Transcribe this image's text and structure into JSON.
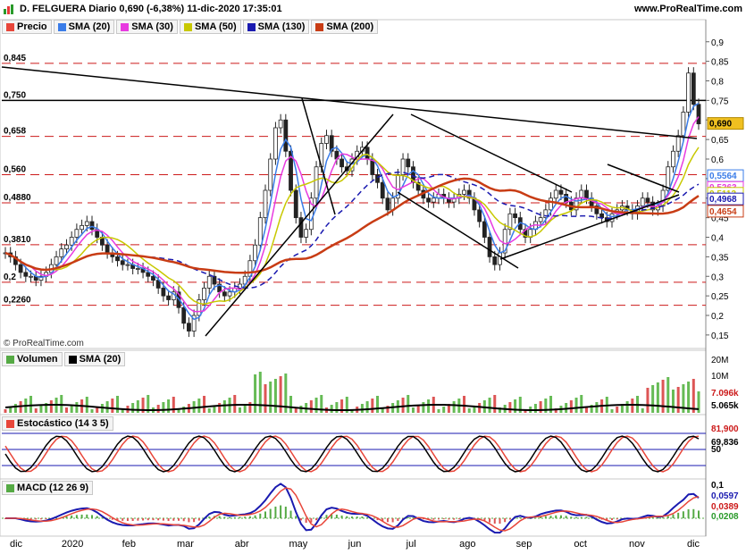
{
  "header": {
    "title": "D. FELGUERA Diario 0,690 (-6,38%) 11-dic-2020 17:35:01",
    "site": "www.ProRealTime.com",
    "copyright": "© ProRealTime.com"
  },
  "price_legend": [
    {
      "label": "Precio",
      "color": "#e8463a"
    },
    {
      "label": "SMA (20)",
      "color": "#3a7ce8"
    },
    {
      "label": "SMA (30)",
      "color": "#e83ae0"
    },
    {
      "label": "SMA (50)",
      "color": "#c8c800"
    },
    {
      "label": "SMA (130)",
      "color": "#1a1ab0"
    },
    {
      "label": "SMA (200)",
      "color": "#c83c14"
    }
  ],
  "volume_legend": [
    {
      "label": "Volumen",
      "color": "#55aa44"
    },
    {
      "label": "SMA (20)",
      "color": "#000000"
    }
  ],
  "stoch_legend": [
    {
      "label": "Estocástico (14 3 5)",
      "color": "#e8463a"
    }
  ],
  "macd_legend": [
    {
      "label": "MACD (12 26 9)",
      "color": "#55aa44"
    }
  ],
  "chart_data": [
    {
      "type": "candlestick",
      "title": "D. FELGUERA Diario",
      "x_labels": [
        "dic",
        "2020",
        "feb",
        "mar",
        "abr",
        "may",
        "jun",
        "jul",
        "ago",
        "sep",
        "oct",
        "nov",
        "dic"
      ],
      "ylim": [
        0.12,
        0.92
      ],
      "y_ticks": [
        "0,9",
        "0,85",
        "0,8",
        "0,75",
        "0,7",
        "0,65",
        "0,6",
        "0,55",
        "0,5",
        "0,45",
        "0,4",
        "0,35",
        "0,3",
        "0,25",
        "0,2",
        "0,15"
      ],
      "reference_levels": [
        {
          "label": "0,845",
          "value": 0.845
        },
        {
          "label": "0,750",
          "value": 0.75
        },
        {
          "label": "0,658",
          "value": 0.658
        },
        {
          "label": "0,560",
          "value": 0.56
        },
        {
          "label": "0,4880",
          "value": 0.488
        },
        {
          "label": "0,3810",
          "value": 0.381
        },
        {
          "label": "0,2",
          "value": 0.285
        },
        {
          "label": "0,2260",
          "value": 0.226
        }
      ],
      "value_tags": [
        {
          "label": "0,690",
          "value": 0.69,
          "color": "#f0c020",
          "text": "#000000"
        },
        {
          "label": "0,5564",
          "value": 0.5564,
          "color": "#ffffff",
          "text": "#3a7ce8"
        },
        {
          "label": "0,5263",
          "value": 0.5263,
          "color": "#ffffff",
          "text": "#e83ae0"
        },
        {
          "label": "0,5113",
          "value": 0.5113,
          "color": "#ffffff",
          "text": "#c8c800"
        },
        {
          "label": "0,4968",
          "value": 0.4968,
          "color": "#ffffff",
          "text": "#1a1ab0"
        },
        {
          "label": "0,4654",
          "value": 0.4654,
          "color": "#ffffff",
          "text": "#c83c14"
        }
      ],
      "close": [
        0.36,
        0.35,
        0.33,
        0.31,
        0.3,
        0.3,
        0.29,
        0.3,
        0.31,
        0.33,
        0.35,
        0.37,
        0.38,
        0.4,
        0.42,
        0.43,
        0.44,
        0.42,
        0.4,
        0.38,
        0.36,
        0.35,
        0.34,
        0.33,
        0.33,
        0.32,
        0.32,
        0.31,
        0.3,
        0.29,
        0.27,
        0.25,
        0.24,
        0.26,
        0.22,
        0.18,
        0.16,
        0.2,
        0.24,
        0.27,
        0.3,
        0.28,
        0.26,
        0.25,
        0.26,
        0.27,
        0.28,
        0.3,
        0.34,
        0.38,
        0.45,
        0.52,
        0.6,
        0.68,
        0.7,
        0.62,
        0.52,
        0.45,
        0.4,
        0.42,
        0.5,
        0.58,
        0.64,
        0.66,
        0.62,
        0.6,
        0.58,
        0.57,
        0.6,
        0.62,
        0.63,
        0.6,
        0.56,
        0.54,
        0.5,
        0.47,
        0.5,
        0.56,
        0.6,
        0.58,
        0.54,
        0.52,
        0.5,
        0.49,
        0.5,
        0.51,
        0.5,
        0.49,
        0.5,
        0.51,
        0.52,
        0.5,
        0.47,
        0.44,
        0.4,
        0.35,
        0.33,
        0.36,
        0.42,
        0.46,
        0.45,
        0.42,
        0.4,
        0.42,
        0.44,
        0.45,
        0.47,
        0.5,
        0.52,
        0.51,
        0.49,
        0.47,
        0.5,
        0.52,
        0.5,
        0.48,
        0.46,
        0.45,
        0.44,
        0.46,
        0.47,
        0.48,
        0.47,
        0.46,
        0.48,
        0.5,
        0.49,
        0.47,
        0.48,
        0.52,
        0.58,
        0.62,
        0.66,
        0.72,
        0.82,
        0.74,
        0.69
      ]
    },
    {
      "type": "bar",
      "title": "Volumen",
      "y_ticks": [
        "20M",
        "10M",
        "7.096k",
        "5.065k"
      ]
    },
    {
      "type": "line",
      "title": "Estocástico (14 3 5)",
      "y_ticks": [
        "81,900",
        "69,836",
        "50"
      ]
    },
    {
      "type": "line",
      "title": "MACD (12 26 9)",
      "y_ticks": [
        "0,1",
        "0,0597",
        "0,0389",
        "0,0208",
        "0"
      ]
    }
  ]
}
